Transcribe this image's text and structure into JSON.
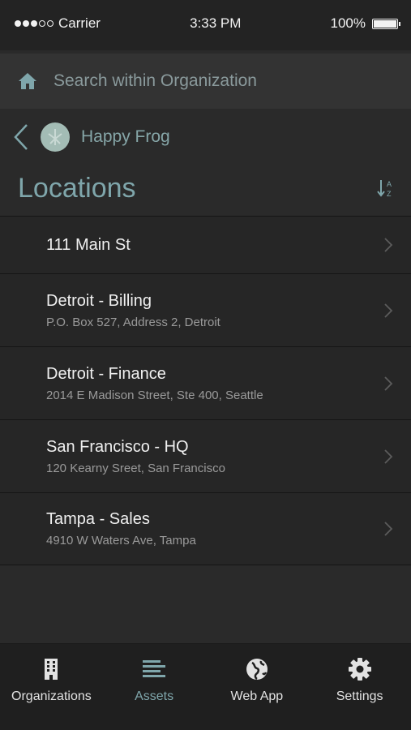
{
  "status_bar": {
    "carrier": "Carrier",
    "time": "3:33 PM",
    "battery": "100%",
    "signal_bars": 3,
    "signal_total": 5
  },
  "search": {
    "placeholder": "Search within Organization"
  },
  "organization": {
    "name": "Happy Frog"
  },
  "section": {
    "title": "Locations"
  },
  "locations": [
    {
      "title": "111 Main St",
      "address": ""
    },
    {
      "title": "Detroit - Billing",
      "address": "P.O. Box 527, Address 2, Detroit"
    },
    {
      "title": "Detroit - Finance",
      "address": "2014 E Madison Street, Ste 400, Seattle"
    },
    {
      "title": "San Francisco - HQ",
      "address": "120 Kearny Sreet, San Francisco"
    },
    {
      "title": "Tampa - Sales",
      "address": "4910 W Waters Ave, Tampa"
    }
  ],
  "tabbar": {
    "items": [
      {
        "label": "Organizations",
        "icon": "building-icon"
      },
      {
        "label": "Assets",
        "icon": "list-icon",
        "active": true
      },
      {
        "label": "Web App",
        "icon": "globe-icon"
      },
      {
        "label": "Settings",
        "icon": "gear-icon"
      }
    ]
  },
  "colors": {
    "accent": "#7fa6ab",
    "background": "#2a2a2a"
  }
}
